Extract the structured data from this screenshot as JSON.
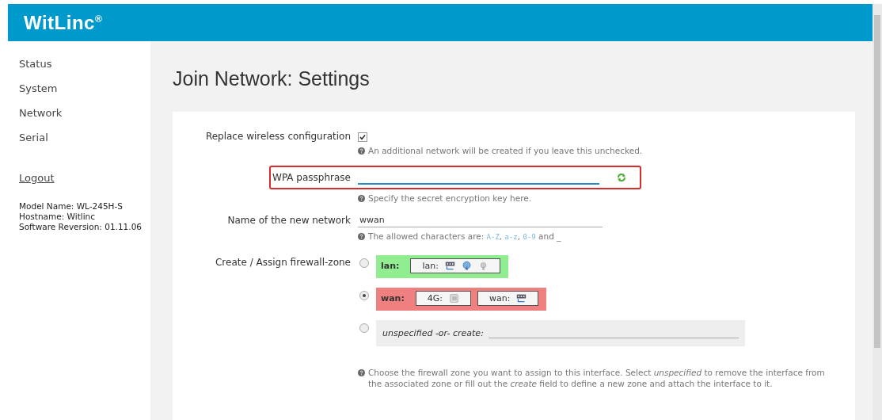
{
  "header": {
    "logo": "WitLinc",
    "logo_mark": "®"
  },
  "sidebar": {
    "items": [
      {
        "label": "Status"
      },
      {
        "label": "System"
      },
      {
        "label": "Network"
      },
      {
        "label": "Serial"
      }
    ],
    "logout": "Logout",
    "info": [
      "Model Name: WL-245H-S",
      "Hostname: Witlinc",
      "Software Reversion: 01.11.06"
    ]
  },
  "page_title": "Join Network: Settings",
  "form": {
    "replace": {
      "label": "Replace wireless configuration",
      "checked": true,
      "hint": "An additional network will be created if you leave this unchecked."
    },
    "passphrase": {
      "label": "WPA passphrase",
      "focused": true,
      "highlighted": true,
      "hint": "Specify the secret encryption key here."
    },
    "network_name": {
      "label": "Name of the new network",
      "value": "wwan",
      "hint_parts": [
        {
          "kind": "text",
          "text": "The allowed characters are: "
        },
        {
          "kind": "code",
          "text": "A-Z"
        },
        {
          "kind": "text",
          "text": ", "
        },
        {
          "kind": "code",
          "text": "a-z"
        },
        {
          "kind": "text",
          "text": ", "
        },
        {
          "kind": "code",
          "text": "0-9"
        },
        {
          "kind": "text",
          "text": " and _"
        }
      ]
    },
    "firewall": {
      "label": "Create / Assign firewall-zone",
      "zones": [
        {
          "kind": "zone",
          "name": "lan:",
          "color": "#90ee90",
          "selected": false,
          "networks": [
            {
              "name": "lan:",
              "kind": "lan"
            }
          ]
        },
        {
          "kind": "zone",
          "name": "wan:",
          "color": "#f08080",
          "selected": true,
          "networks": [
            {
              "name": "4G:",
              "kind": "modem"
            },
            {
              "name": "wan:",
              "kind": "wired"
            }
          ]
        },
        {
          "kind": "create",
          "name": "unspecified -or- create:",
          "selected": false
        }
      ],
      "hint": "Choose the firewall zone you want to assign to this interface. Select *unspecified* to remove the interface from the associated zone or fill out the *create* field to define a new zone and attach the interface to it."
    }
  }
}
